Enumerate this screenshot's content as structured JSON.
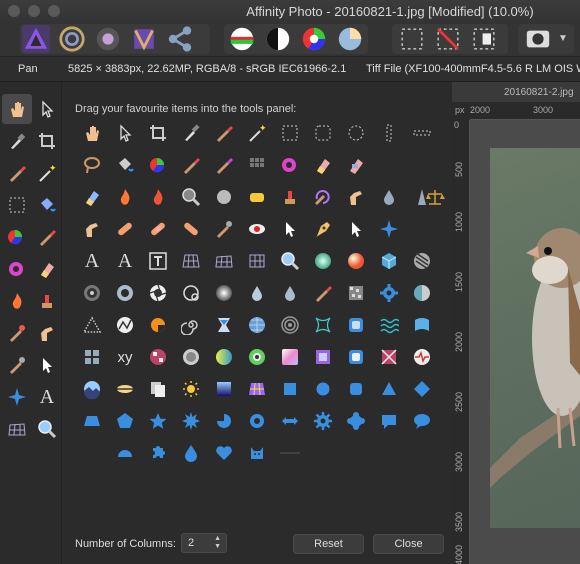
{
  "window": {
    "title": "Affinity Photo - 20160821-1.jpg [Modified] (10.0%)"
  },
  "infobar": {
    "tool": "Pan",
    "dimensions": "5825 × 3883px, 22.62MP, RGBA/8 - sRGB IEC61966-2.1",
    "lens": "Tiff File (XF100-400mmF4.5-5.6 R LM OIS W"
  },
  "customize": {
    "hint": "Drag your favourite items into the tools panel:",
    "columns_label": "Number of Columns:",
    "columns_value": "2",
    "reset_label": "Reset",
    "close_label": "Close",
    "text_tool_a": "A",
    "text_tool_b": "A",
    "xy_label": "xy"
  },
  "document": {
    "tab": "20160821-2.jpg",
    "ruler_unit": "px",
    "h_ticks": [
      "2000",
      "3000"
    ],
    "v_ticks": [
      "0",
      "500",
      "1000",
      "1500",
      "2000",
      "2500",
      "3000",
      "3500",
      "4000"
    ]
  },
  "colors": {
    "accent": "#7b4ccf",
    "blue_shape": "#3a8ee0",
    "bg": "#2b2b2b"
  }
}
